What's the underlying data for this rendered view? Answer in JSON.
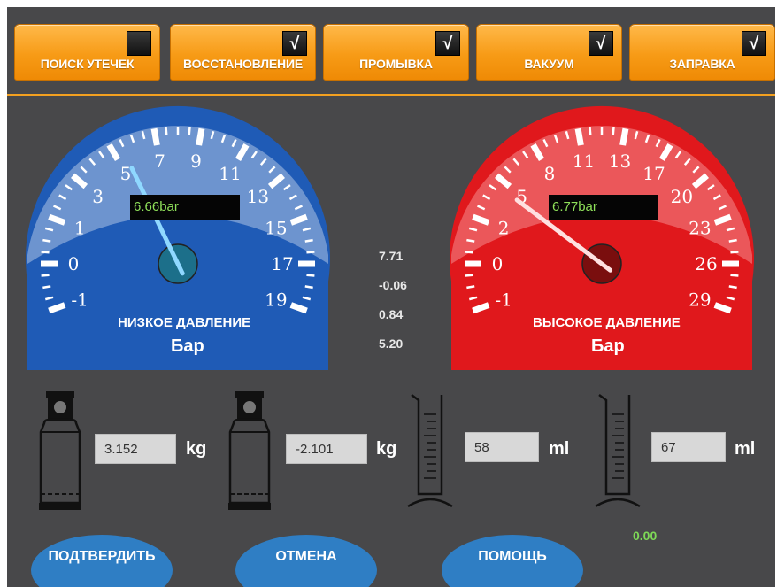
{
  "tabs": [
    {
      "label": "ПОИСК УТЕЧЕК",
      "checked": false
    },
    {
      "label": "ВОССТАНОВЛЕНИЕ",
      "checked": true
    },
    {
      "label": "ПРОМЫВКА",
      "checked": true
    },
    {
      "label": "ВАКУУМ",
      "checked": true
    },
    {
      "label": "ЗАПРАВКА",
      "checked": true
    }
  ],
  "check_mark": "√",
  "low_gauge": {
    "readout": "6.66bar",
    "title": "НИЗКОЕ ДАВЛЕНИЕ",
    "unit": "Бар",
    "scale": [
      "-1",
      "0",
      "1",
      "3",
      "5",
      "7",
      "9",
      "11",
      "13",
      "15",
      "17",
      "19"
    ],
    "value": 6.66,
    "color": "#1f5bb6"
  },
  "high_gauge": {
    "readout": "6.77bar",
    "title": "ВЫСОКОЕ ДАВЛЕНИЕ",
    "unit": "Бар",
    "scale": [
      "-1",
      "0",
      "2",
      "5",
      "8",
      "11",
      "13",
      "17",
      "20",
      "23",
      "26",
      "29"
    ],
    "value": 6.77,
    "color": "#e0181c"
  },
  "side_values": [
    "7.71",
    "-0.06",
    "0.84",
    "5.20"
  ],
  "bottle1": {
    "value": "3.152",
    "unit": "kg"
  },
  "bottle2": {
    "value": "-2.101",
    "unit": "kg"
  },
  "cylinder1": {
    "value": "58",
    "unit": "ml"
  },
  "cylinder2": {
    "value": "67",
    "unit": "ml"
  },
  "status_value": "0.00",
  "buttons": {
    "confirm": "ПОДТВЕРДИТЬ",
    "cancel": "ОТМЕНА",
    "help": "ПОМОЩЬ"
  }
}
